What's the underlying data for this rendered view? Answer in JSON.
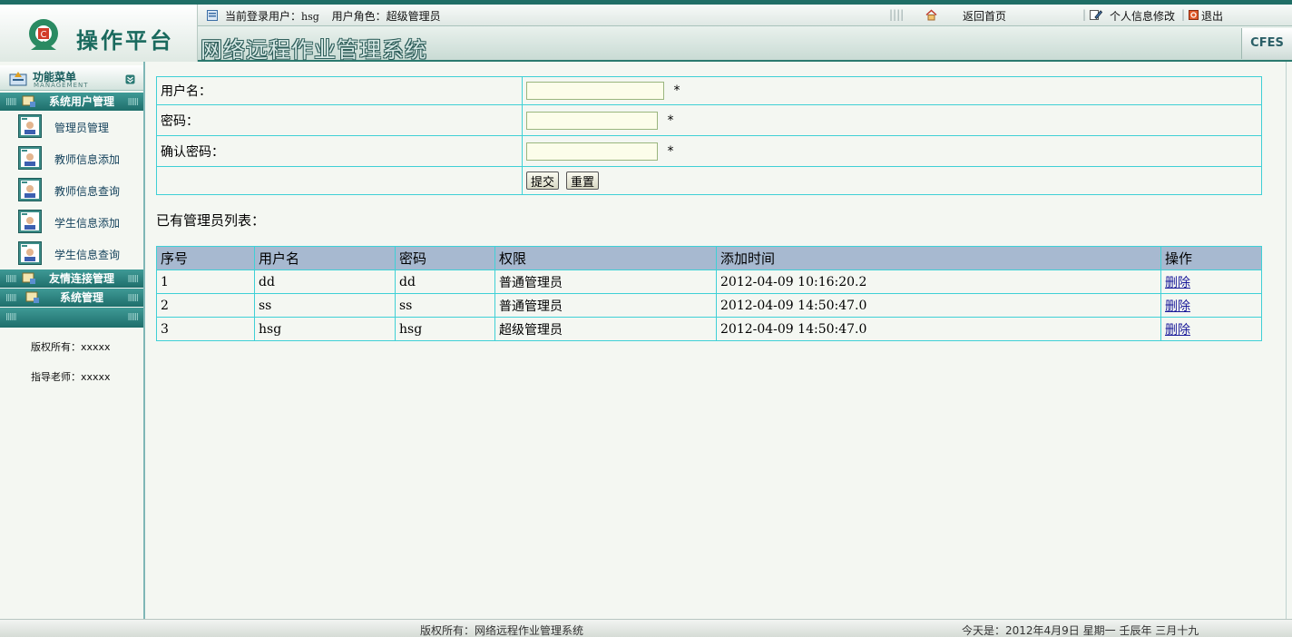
{
  "header": {
    "brand": "操作平台",
    "system_title": "网络远程作业管理系统",
    "corner_badge": "CFES",
    "current_user_label": "当前登录用户：",
    "current_user": "hsg",
    "role_label": "用户角色：",
    "role": "超级管理员",
    "home_link": "返回首页",
    "profile_link": "个人信息修改",
    "logout_link": "退出"
  },
  "sidebar": {
    "menu_title": "功能菜单",
    "menu_subtitle": "MANAGEMENT",
    "sections": [
      {
        "label": "系统用户管理"
      },
      {
        "label": "友情连接管理"
      },
      {
        "label": "系统管理"
      }
    ],
    "items": [
      {
        "label": "管理员管理"
      },
      {
        "label": "教师信息添加"
      },
      {
        "label": "教师信息查询"
      },
      {
        "label": "学生信息添加"
      },
      {
        "label": "学生信息查询"
      }
    ],
    "copyright": "版权所有：xxxxx",
    "advisor": "指导老师：xxxxx"
  },
  "form": {
    "username_label": "用户名：",
    "password_label": "密码：",
    "confirm_label": "确认密码：",
    "required_mark": "*",
    "username_value": "",
    "password_value": "",
    "confirm_value": "",
    "submit_label": "提交",
    "reset_label": "重置"
  },
  "list": {
    "title": "已有管理员列表：",
    "columns": [
      "序号",
      "用户名",
      "密码",
      "权限",
      "添加时间",
      "操作"
    ],
    "rows": [
      {
        "no": "1",
        "username": "dd",
        "password": "dd",
        "role": "普通管理员",
        "time": "2012-04-09 10:16:20.2",
        "action": "删除"
      },
      {
        "no": "2",
        "username": "ss",
        "password": "ss",
        "role": "普通管理员",
        "time": "2012-04-09 14:50:47.0",
        "action": "删除"
      },
      {
        "no": "3",
        "username": "hsg",
        "password": "hsg",
        "role": "超级管理员",
        "time": "2012-04-09 14:50:47.0",
        "action": "删除"
      }
    ]
  },
  "footer": {
    "copyright": "版权所有：网络远程作业管理系统",
    "date": "今天是：2012年4月9日  星期一  壬辰年  三月十九"
  },
  "colors": {
    "accent": "#1f6e66",
    "table_border": "#3fd0d6",
    "table_header": "#a7b9d0"
  }
}
